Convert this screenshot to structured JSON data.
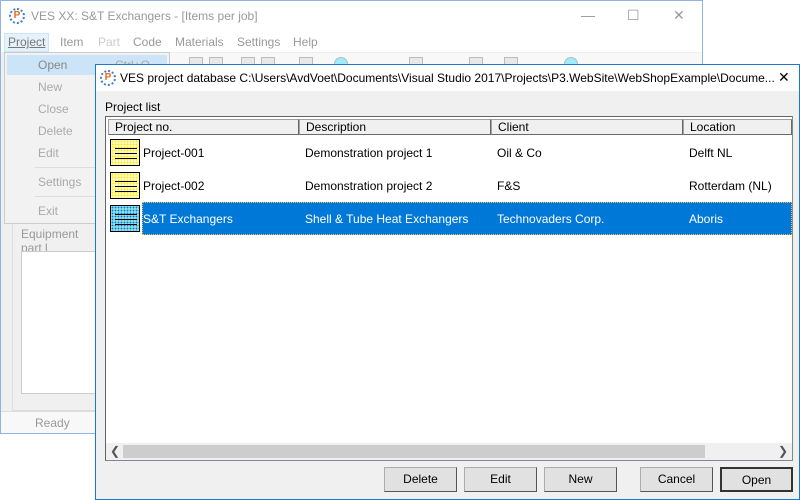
{
  "main_window": {
    "title": "VES XX: S&T Exchangers - [Items per job]",
    "menu": [
      "Project",
      "Item",
      "Part",
      "Code",
      "Materials",
      "Settings",
      "Help"
    ],
    "project_menu": {
      "items": [
        {
          "label": "Open",
          "shortcut": "Ctrl+O"
        },
        {
          "label": "New"
        },
        {
          "label": "Close"
        },
        {
          "label": "Delete"
        },
        {
          "label": "Edit"
        },
        {
          "label": "Settings"
        },
        {
          "label": "Exit"
        }
      ]
    },
    "equipment_label": "Equipment part l",
    "status": "Ready"
  },
  "dialog": {
    "title": "VES project database C:\\Users\\AvdVoet\\Documents\\Visual Studio 2017\\Projects\\P3.WebSite\\WebShopExample\\Docume...",
    "list_label": "Project list",
    "columns": [
      "Project no.",
      "Description",
      "Client",
      "Location"
    ],
    "rows": [
      {
        "no": "Project-001",
        "description": "Demonstration project 1",
        "client": "Oil & Co",
        "location": "Delft NL",
        "selected": false
      },
      {
        "no": "Project-002",
        "description": "Demonstration project 2",
        "client": "F&S",
        "location": "Rotterdam (NL)",
        "selected": false
      },
      {
        "no": "S&T Exchangers",
        "description": "Shell & Tube Heat Exchangers",
        "client": "Technovaders Corp.",
        "location": "Aboris",
        "selected": true
      }
    ],
    "buttons": {
      "delete": "Delete",
      "edit": "Edit",
      "new": "New",
      "cancel": "Cancel",
      "open": "Open"
    },
    "selection_color": "#0078d7"
  }
}
